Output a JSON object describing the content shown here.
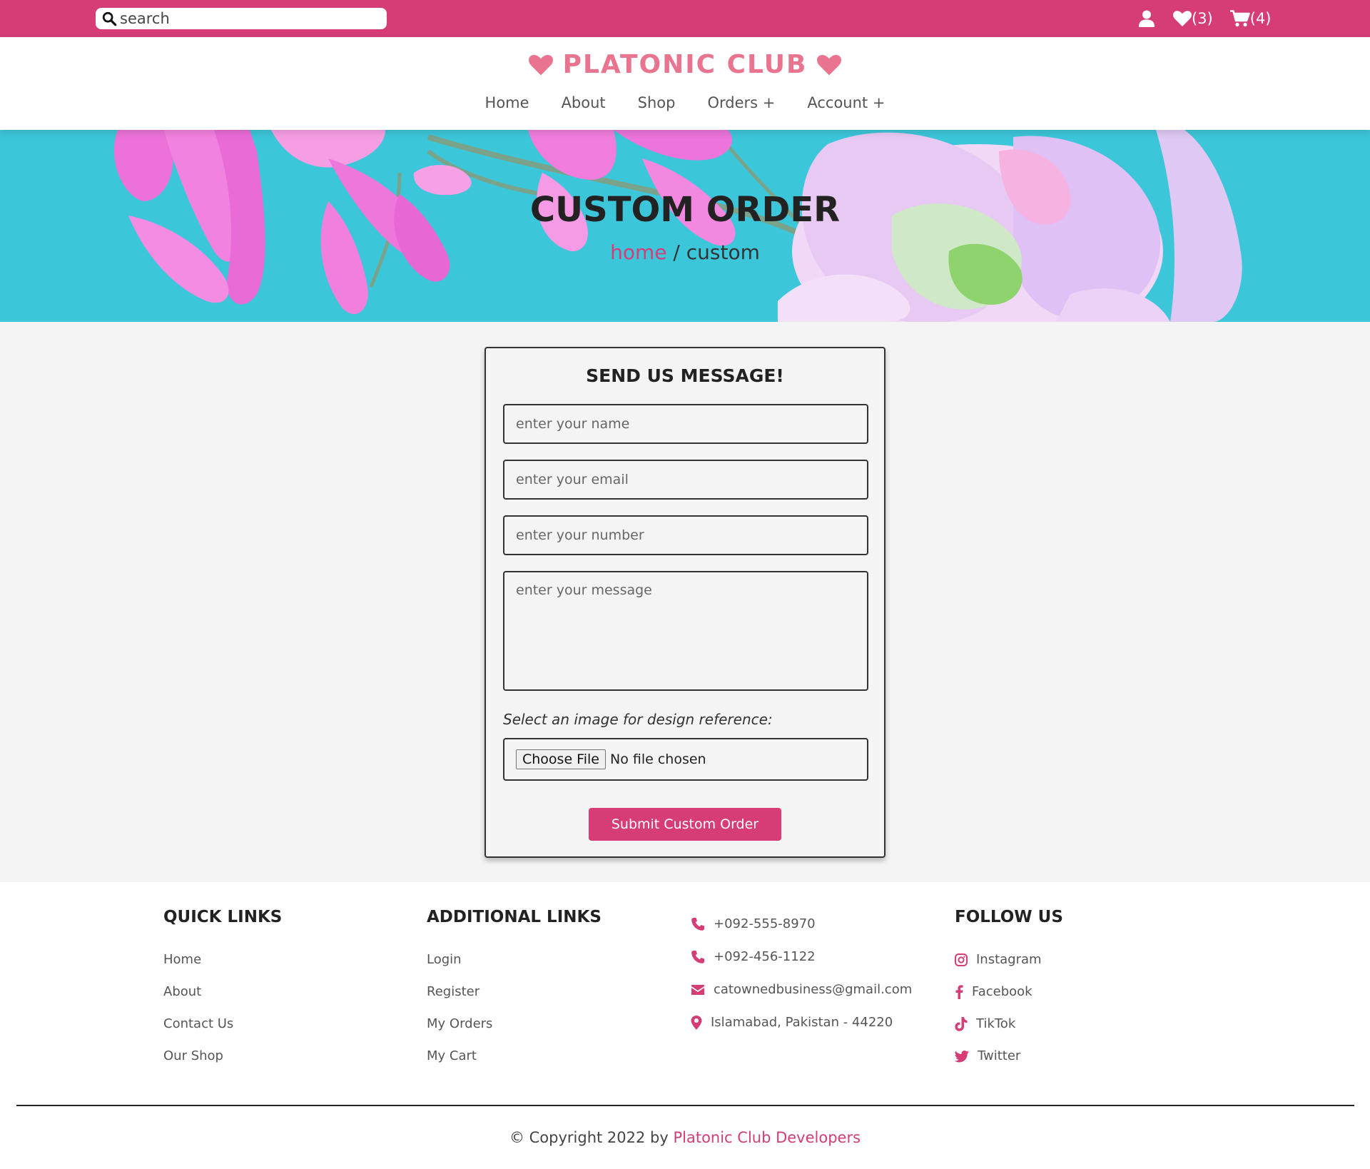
{
  "topbar": {
    "search_placeholder": "search",
    "wishlist_count": "(3)",
    "cart_count": "(4)"
  },
  "brand": {
    "name": "PLATONIC CLUB"
  },
  "nav": {
    "home": "Home",
    "about": "About",
    "shop": "Shop",
    "orders": "Orders +",
    "account": "Account +"
  },
  "hero": {
    "title": "CUSTOM ORDER",
    "crumb_home": "home",
    "crumb_sep": " / ",
    "crumb_current": "custom"
  },
  "form": {
    "title": "SEND US MESSAGE!",
    "name_placeholder": "enter your name",
    "email_placeholder": "enter your email",
    "number_placeholder": "enter your number",
    "message_placeholder": "enter your message",
    "file_label": "Select an image for design reference:",
    "file_button": "Choose File",
    "file_status": "No file chosen",
    "submit_label": "Submit Custom Order"
  },
  "footer": {
    "quick_links": {
      "title": "QUICK LINKS",
      "items": [
        "Home",
        "About",
        "Contact Us",
        "Our Shop"
      ]
    },
    "additional_links": {
      "title": "ADDITIONAL LINKS",
      "items": [
        "Login",
        "Register",
        "My Orders",
        "My Cart"
      ]
    },
    "contact": {
      "phone1": "+092-555-8970",
      "phone2": "+092-456-1122",
      "email": "catownedbusiness@gmail.com",
      "address": "Islamabad, Pakistan - 44220"
    },
    "follow": {
      "title": "FOLLOW US",
      "instagram": "Instagram",
      "facebook": "Facebook",
      "tiktok": "TikTok",
      "twitter": "Twitter"
    },
    "copyright_prefix": "© Copyright 2022 by ",
    "copyright_link": "Platonic Club Developers"
  },
  "colors": {
    "accent": "#d63d77",
    "brand": "#e8748f",
    "hero_bg": "#3cc6d9",
    "section_bg": "#f4f4f4"
  },
  "icons": {
    "search": "search-icon",
    "user": "user-icon",
    "wishlist": "heart-icon",
    "cart": "cart-icon",
    "phone": "phone-icon",
    "email": "envelope-icon",
    "location": "map-pin-icon",
    "instagram": "instagram-icon",
    "facebook": "facebook-icon",
    "tiktok": "tiktok-icon",
    "twitter": "twitter-icon"
  }
}
